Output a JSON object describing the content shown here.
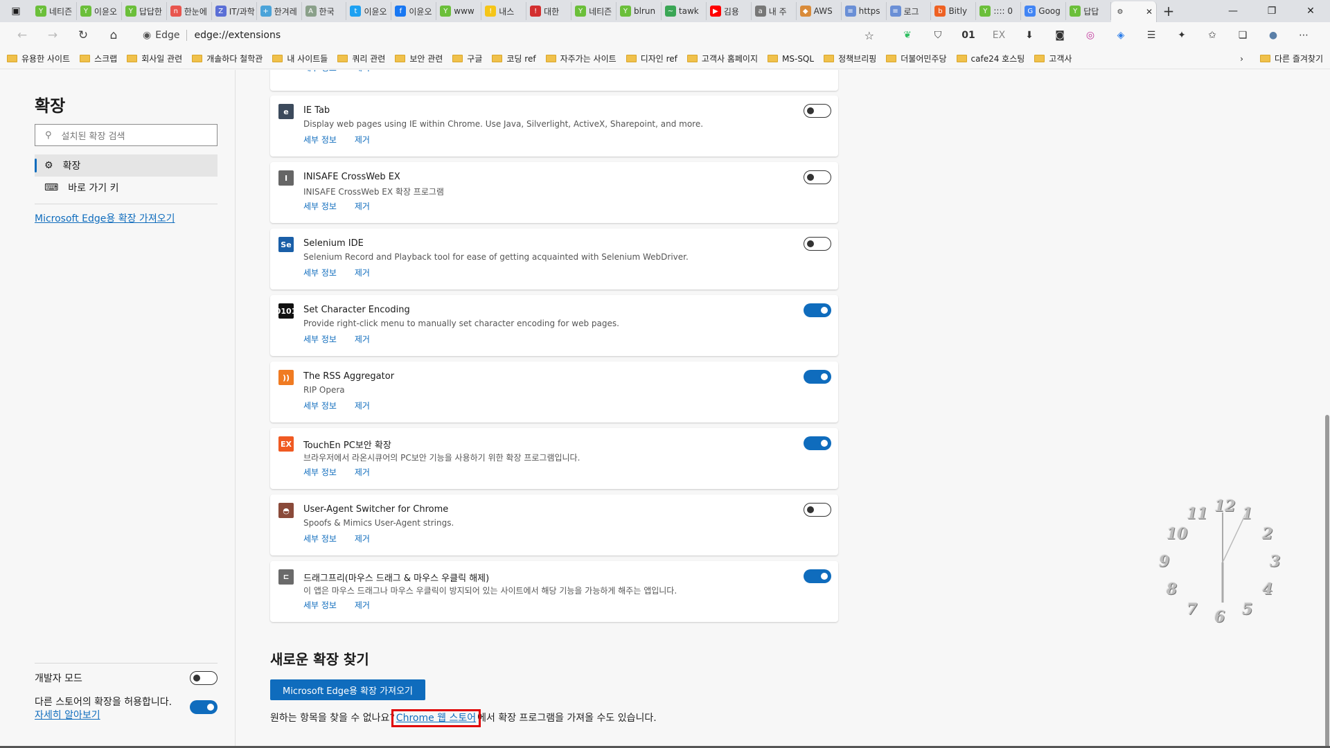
{
  "tabs": [
    {
      "label": "네티즌",
      "color": "#6bbf3a",
      "glyph": "Y"
    },
    {
      "label": "이윤오",
      "color": "#6bbf3a",
      "glyph": "Y"
    },
    {
      "label": "답답한",
      "color": "#6bbf3a",
      "glyph": "Y"
    },
    {
      "label": "한눈에",
      "color": "#e8554e",
      "glyph": "n"
    },
    {
      "label": "IT/과학",
      "color": "#5b6fd6",
      "glyph": "Z"
    },
    {
      "label": "한겨레",
      "color": "#4aa3d9",
      "glyph": "+"
    },
    {
      "label": "한국",
      "color": "#8aa08a",
      "glyph": "A"
    },
    {
      "label": "이윤오",
      "color": "#1da1f2",
      "glyph": "t"
    },
    {
      "label": "이윤오",
      "color": "#1877f2",
      "glyph": "f"
    },
    {
      "label": "www",
      "color": "#6bbf3a",
      "glyph": "Y"
    },
    {
      "label": "내스",
      "color": "#f5c518",
      "glyph": "!"
    },
    {
      "label": "대한",
      "color": "#d32f2f",
      "glyph": "!"
    },
    {
      "label": "네티즌",
      "color": "#6bbf3a",
      "glyph": "Y"
    },
    {
      "label": "blrun",
      "color": "#6bbf3a",
      "glyph": "Y"
    },
    {
      "label": "tawk",
      "color": "#3aa655",
      "glyph": "~"
    },
    {
      "label": "김용",
      "color": "#ff0000",
      "glyph": "▶"
    },
    {
      "label": "내 주",
      "color": "#777777",
      "glyph": "a"
    },
    {
      "label": "AWS",
      "color": "#d98b3a",
      "glyph": "◆"
    },
    {
      "label": "https",
      "color": "#6a8fd6",
      "glyph": "≡"
    },
    {
      "label": "로그",
      "color": "#6a8fd6",
      "glyph": "≡"
    },
    {
      "label": "Bitly",
      "color": "#ee6123",
      "glyph": "b"
    },
    {
      "label": ":::: 0",
      "color": "#6bbf3a",
      "glyph": "Y"
    },
    {
      "label": "Goog",
      "color": "#4285f4",
      "glyph": "G"
    },
    {
      "label": "답답",
      "color": "#6bbf3a",
      "glyph": "Y"
    }
  ],
  "address": {
    "label": "Edge",
    "url": "edge://extensions"
  },
  "bookmarks": [
    {
      "label": "유용한 사이트"
    },
    {
      "label": "스크랩"
    },
    {
      "label": "회사일 관련"
    },
    {
      "label": "개솔하다 철학관"
    },
    {
      "label": "내 사이트들"
    },
    {
      "label": "쿼리 관련"
    },
    {
      "label": "보안 관련"
    },
    {
      "label": "구글"
    },
    {
      "label": "코딩 ref"
    },
    {
      "label": "자주가는 사이트"
    },
    {
      "label": "디자인 ref"
    },
    {
      "label": "고객사 홈페이지"
    },
    {
      "label": "MS-SQL"
    },
    {
      "label": "정책브리핑"
    },
    {
      "label": "더불어민주당"
    },
    {
      "label": "cafe24 호스팅"
    },
    {
      "label": "고객사"
    }
  ],
  "bookmarks_other": "다른 즐겨찾기",
  "sidebar": {
    "title": "확장",
    "search_placeholder": "설치된 확장 검색",
    "nav": [
      {
        "label": "확장"
      },
      {
        "label": "바로 가기 키"
      }
    ],
    "get_link": "Microsoft Edge용 확장 가져오기",
    "dev_mode": "개발자 모드",
    "allow_other_stores": "다른 스토어의 확장을 허용합니다.",
    "learn_more": "자세히 알아보기"
  },
  "link_labels": {
    "details": "세부 정보",
    "remove": "제거"
  },
  "extensions": [
    {
      "name": "IE Tab",
      "desc": "Display web pages using IE within Chrome. Use Java, Silverlight, ActiveX, Sharepoint, and more.",
      "enabled": false,
      "icon": "e",
      "icon_color": "#3c4a5c"
    },
    {
      "name": "INISAFE CrossWeb EX",
      "desc": "INISAFE CrossWeb EX 확장 프로그램",
      "enabled": false,
      "icon": "I",
      "icon_color": "#666666"
    },
    {
      "name": "Selenium IDE",
      "desc": "Selenium Record and Playback tool for ease of getting acquainted with Selenium WebDriver.",
      "enabled": false,
      "icon": "Se",
      "icon_color": "#1a5fa8"
    },
    {
      "name": "Set Character Encoding",
      "desc": "Provide right-click menu to manually set character encoding for web pages.",
      "enabled": true,
      "icon": "0101",
      "icon_color": "#111111"
    },
    {
      "name": "The RSS Aggregator",
      "desc": "RIP Opera",
      "enabled": true,
      "icon": "))",
      "icon_color": "#f07b22"
    },
    {
      "name": "TouchEn PC보안 확장",
      "desc": "브라우저에서 라온시큐어의 PC보안 기능을 사용하기 위한 확장 프로그램입니다.",
      "enabled": true,
      "icon": "EX",
      "icon_color": "#f05a22"
    },
    {
      "name": "User-Agent Switcher for Chrome",
      "desc": "Spoofs & Mimics User-Agent strings.",
      "enabled": false,
      "icon": "◓",
      "icon_color": "#8a4a3a"
    },
    {
      "name": "드래그프리(마우스 드래그 & 마우스 우클릭 해제)",
      "desc": "이 앱은 마우스 드래그나 마우스 우클릭이 방지되어 있는 사이트에서 해당 기능을 가능하게 해주는 앱입니다.",
      "enabled": true,
      "icon": "ㄷ",
      "icon_color": "#6a6a6a"
    }
  ],
  "find": {
    "title": "새로운 확장 찾기",
    "button": "Microsoft Edge용 확장 가져오기",
    "prefix": "원하는 항목을 찾을 수 없나요?",
    "store_link": "Chrome 웹 스토어",
    "suffix": "에서 확장 프로그램을 가져올 수도 있습니다."
  },
  "clock_numbers": [
    "12",
    "1",
    "2",
    "3",
    "4",
    "5",
    "6",
    "7",
    "8",
    "9",
    "10",
    "11"
  ]
}
